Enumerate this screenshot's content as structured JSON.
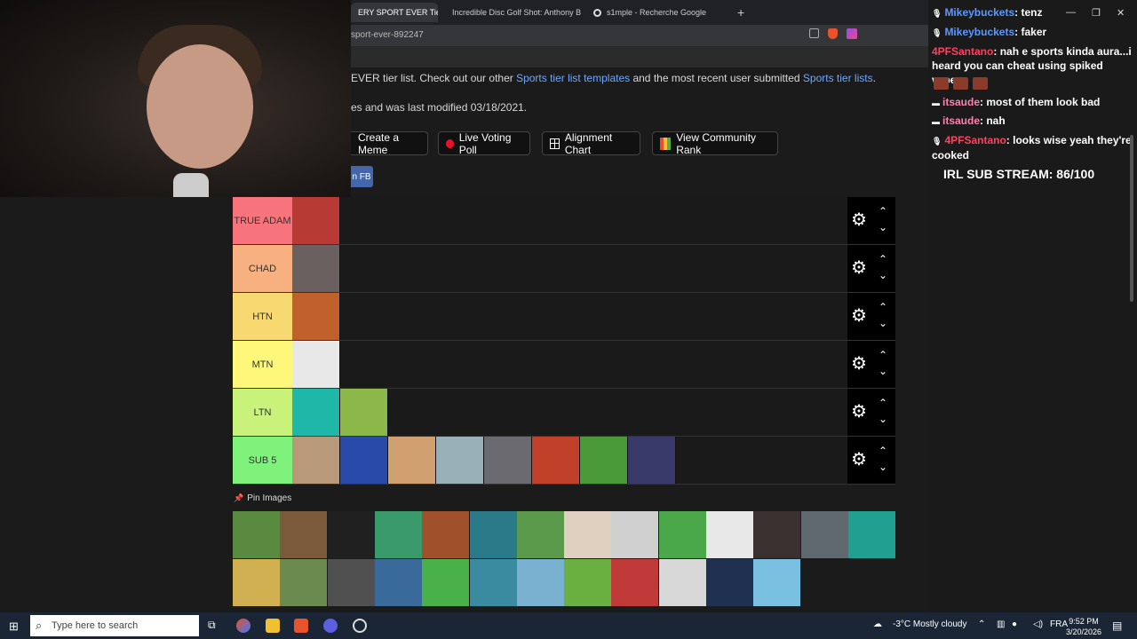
{
  "tabs": [
    {
      "label": "ERY SPORT EVER Tie",
      "active": true
    },
    {
      "label": "Incredible Disc Golf Shot: Anthony B"
    },
    {
      "label": "s1mple - Recherche Google"
    }
  ],
  "address": {
    "url": "sport-ever-892247"
  },
  "intro": {
    "line1_prefix": "EVER tier list. Check out our other ",
    "line1_link1": "Sports tier list templates",
    "line1_mid": " and the most recent user submitted ",
    "line1_link2": "Sports tier lists",
    "line1_suffix": ".",
    "line2": "es and was last modified 03/18/2021."
  },
  "buttons": {
    "meme": "Create a Meme",
    "poll": "Live Voting Poll",
    "alignment": "Alignment Chart",
    "community": "View Community Rank",
    "fb": "n FB"
  },
  "tiers": [
    {
      "label": "TRUE ADAM",
      "color": "#f7747c",
      "items": [
        "#b83a35"
      ]
    },
    {
      "label": "CHAD",
      "color": "#f7b080",
      "items": [
        "#6a6060"
      ]
    },
    {
      "label": "HTN",
      "color": "#f8d870",
      "items": [
        "#c0602a"
      ]
    },
    {
      "label": "MTN",
      "color": "#fdf87a",
      "items": [
        "#e8e8e8"
      ]
    },
    {
      "label": "LTN",
      "color": "#c8f27a",
      "items": [
        "#1fb8a8",
        "#8cb84a"
      ]
    },
    {
      "label": "SUB 5",
      "color": "#7ef27a",
      "items": [
        "#b89a7a",
        "#2a4aaa",
        "#d0a070",
        "#9ab0b8",
        "#6a6a70",
        "#c0402a",
        "#4a9a3a",
        "#3a3a6a"
      ]
    }
  ],
  "tier_controls": {
    "gear": "⚙",
    "up": "⌃",
    "down": "⌄"
  },
  "pin": {
    "icon": "📌",
    "label": "Pin Images"
  },
  "pool": [
    "#5a8a40",
    "#7a5a3a",
    "#202020",
    "#3a9a6a",
    "#a0502a",
    "#2a7a8a",
    "#5a9a4a",
    "#e0d0c0",
    "#d0d0d0",
    "#4aa84a",
    "#e8e8e8",
    "#3a3030",
    "#606870",
    "#20a090",
    "#d0b050",
    "#6a8a50",
    "#505050",
    "#3a6a9a",
    "#4ab04a",
    "#3a8aa0",
    "#7ab0d0",
    "#6ab040",
    "#c03a3a",
    "#d8d8d8",
    "#203050",
    "#7ac0e0"
  ],
  "chat": [
    {
      "user": "Mikeybuckets",
      "color": "#5a9aff",
      "text": ": tenz"
    },
    {
      "user": "Mikeybuckets",
      "color": "#5a9aff",
      "text": ": faker"
    },
    {
      "user": "4PFSantano",
      "color": "#ff4060",
      "text": ": nah e sports kinda aura...i heard you can cheat using spiked vapes"
    },
    {
      "user": "itsaude",
      "color": "#ff80b0",
      "text": ": most of them look bad"
    },
    {
      "user": "itsaude",
      "color": "#ff80b0",
      "text": ": nah"
    },
    {
      "user": "4PFSantano",
      "color": "#ff4060",
      "text": ": looks wise yeah they're cooked"
    }
  ],
  "sub_stream": "IRL SUB STREAM: 86/100",
  "taskbar": {
    "search_placeholder": "Type here to search",
    "weather": "-3°C  Mostly cloudy",
    "lang": "FRA",
    "time": "9:52 PM",
    "date": "3/20/2026"
  }
}
